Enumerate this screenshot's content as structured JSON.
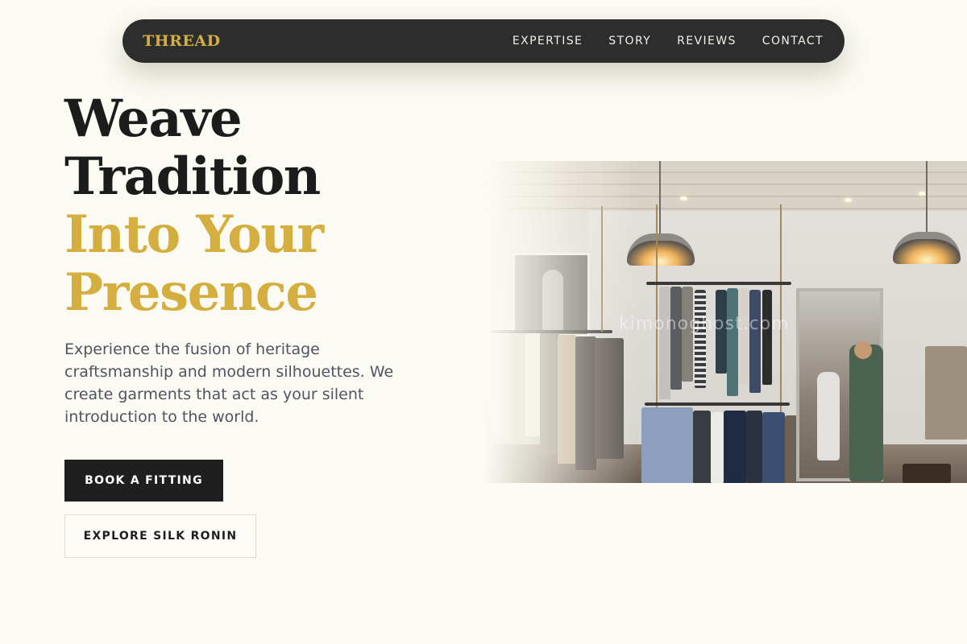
{
  "nav": {
    "brand": "THREAD",
    "links": [
      "EXPERTISE",
      "STORY",
      "REVIEWS",
      "CONTACT"
    ]
  },
  "hero": {
    "title_lines": [
      "Weave",
      "Tradition"
    ],
    "highlight_lines": [
      "Into Your",
      "Presence"
    ],
    "subtitle": "Experience the fusion of heritage craftsmanship and modern silhouettes. We create garments that act as your silent introduction to the world.",
    "primary_cta": "BOOK A FITTING",
    "secondary_cta": "EXPLORE SILK RONIN",
    "image_watermark": "kimonoghost.com"
  },
  "colors": {
    "background": "#fcfbf3",
    "nav_background": "#2d2d2d",
    "accent_gold": "#d4ae3e",
    "text_dark": "#1c1c1c",
    "text_muted": "#4e5461"
  }
}
